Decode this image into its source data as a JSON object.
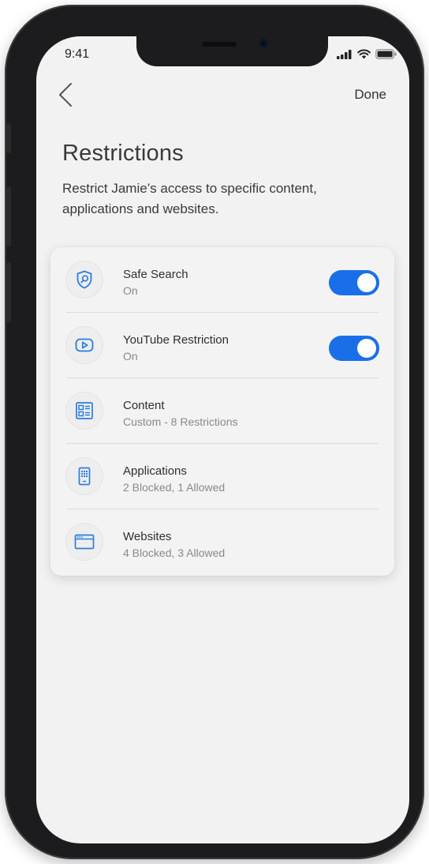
{
  "status_bar": {
    "time": "9:41",
    "signal_icon": "cellular-signal-icon",
    "wifi_icon": "wifi-icon",
    "battery_icon": "battery-icon"
  },
  "nav": {
    "back_icon": "chevron-left-icon",
    "done_label": "Done"
  },
  "page": {
    "title": "Restrictions",
    "subtitle": "Restrict Jamie’s access to specific content, applications and websites."
  },
  "colors": {
    "accent": "#1a6fe8",
    "background": "#f2f2f2",
    "icon_blue": "#2b7de0"
  },
  "restrictions": [
    {
      "label": "Safe Search",
      "value": "On",
      "icon": "shield-search-icon",
      "toggle": true,
      "toggle_on": true
    },
    {
      "label": "YouTube Restriction",
      "value": "On",
      "icon": "youtube-play-icon",
      "toggle": true,
      "toggle_on": true
    },
    {
      "label": "Content",
      "value": "Custom - 8 Restrictions",
      "icon": "content-layout-icon",
      "toggle": false
    },
    {
      "label": "Applications",
      "value": "2 Blocked, 1 Allowed",
      "icon": "phone-apps-icon",
      "toggle": false
    },
    {
      "label": "Websites",
      "value": "4 Blocked, 3 Allowed",
      "icon": "browser-window-icon",
      "toggle": false
    }
  ]
}
